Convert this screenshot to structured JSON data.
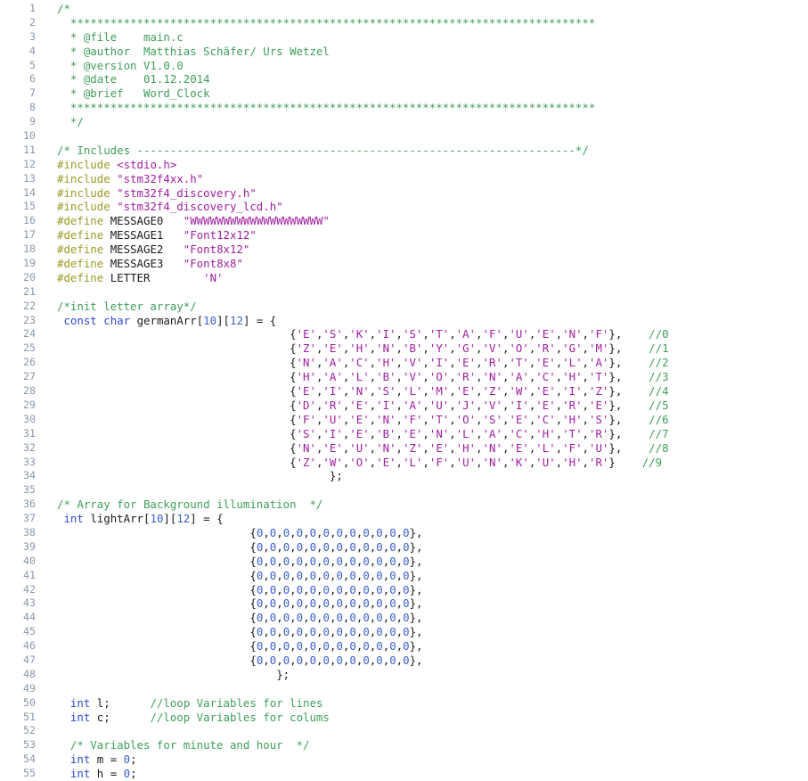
{
  "editor": {
    "name": "code-viewer",
    "language": "C",
    "background": "#ffffff",
    "gutter_color": "#8a97a8",
    "colors": {
      "comment": "#3f9e5a",
      "keyword": "#2c4ad0",
      "preprocessor": "#9a9a23",
      "string": "#a020a0",
      "number": "#3a5fcd",
      "plain": "#1a1a1a"
    },
    "first_line": 1,
    "last_line": 55
  },
  "file_header": {
    "file": "main.c",
    "author": "Matthias Schäfer/ Urs Wetzel",
    "version": "V1.0.0",
    "date": "01.12.2014",
    "brief": "Word_Clock"
  },
  "includes": [
    "<stdio.h>",
    "\"stm32f4xx.h\"",
    "\"stm32f4_discovery.h\"",
    "\"stm32f4_discovery_lcd.h\""
  ],
  "defines": [
    {
      "name": "MESSAGE0",
      "value": "\"WWWWWWWWWWWWWWWWWWWW\""
    },
    {
      "name": "MESSAGE1",
      "value": "\"Font12x12\""
    },
    {
      "name": "MESSAGE2",
      "value": "\"Font8x12\""
    },
    {
      "name": "MESSAGE3",
      "value": "\"Font8x8\""
    },
    {
      "name": "LETTER",
      "value": "'N'"
    }
  ],
  "german_array": {
    "comment": "/*init letter array*/",
    "declaration": "const char germanArr[10][12] = {",
    "rows": [
      {
        "letters": [
          "E",
          "S",
          "K",
          "I",
          "S",
          "T",
          "A",
          "F",
          "U",
          "E",
          "N",
          "F"
        ],
        "index_comment": "//0"
      },
      {
        "letters": [
          "Z",
          "E",
          "H",
          "N",
          "B",
          "Y",
          "G",
          "V",
          "O",
          "R",
          "G",
          "M"
        ],
        "index_comment": "//1"
      },
      {
        "letters": [
          "N",
          "A",
          "C",
          "H",
          "V",
          "I",
          "E",
          "R",
          "T",
          "E",
          "L",
          "A"
        ],
        "index_comment": "//2"
      },
      {
        "letters": [
          "H",
          "A",
          "L",
          "B",
          "V",
          "O",
          "R",
          "N",
          "A",
          "C",
          "H",
          "T"
        ],
        "index_comment": "//3"
      },
      {
        "letters": [
          "E",
          "I",
          "N",
          "S",
          "L",
          "M",
          "E",
          "Z",
          "W",
          "E",
          "I",
          "Z"
        ],
        "index_comment": "//4"
      },
      {
        "letters": [
          "D",
          "R",
          "E",
          "I",
          "A",
          "U",
          "J",
          "V",
          "I",
          "E",
          "R",
          "E"
        ],
        "index_comment": "//5"
      },
      {
        "letters": [
          "F",
          "U",
          "E",
          "N",
          "F",
          "T",
          "O",
          "S",
          "E",
          "C",
          "H",
          "S"
        ],
        "index_comment": "//6"
      },
      {
        "letters": [
          "S",
          "I",
          "E",
          "B",
          "E",
          "N",
          "L",
          "A",
          "C",
          "H",
          "T",
          "R"
        ],
        "index_comment": "//7"
      },
      {
        "letters": [
          "N",
          "E",
          "U",
          "N",
          "Z",
          "E",
          "H",
          "N",
          "E",
          "L",
          "F",
          "U"
        ],
        "index_comment": "//8"
      },
      {
        "letters": [
          "Z",
          "W",
          "O",
          "E",
          "L",
          "F",
          "U",
          "N",
          "K",
          "U",
          "H",
          "R"
        ],
        "index_comment": "//9"
      }
    ],
    "terminator": "};"
  },
  "light_array": {
    "comment": "/* Array for Background illumination  */",
    "declaration": "int lightArr[10][12] = {",
    "row_values": [
      0,
      0,
      0,
      0,
      0,
      0,
      0,
      0,
      0,
      0,
      0,
      0
    ],
    "row_count": 10,
    "terminator": "};"
  },
  "loop_variables": [
    {
      "declaration": "int l;",
      "comment": "//loop Variables for lines"
    },
    {
      "declaration": "int c;",
      "comment": "//loop Variables for colums"
    }
  ],
  "time_variables": {
    "comment": "/* Variables for minute and hour  */",
    "lines": [
      {
        "declaration": "int m = 0;"
      },
      {
        "declaration": "int h = 0;"
      }
    ]
  },
  "separator_stars": "*******************************************************************************",
  "includes_banner": "/* Includes ------------------------------------------------------------------*/"
}
